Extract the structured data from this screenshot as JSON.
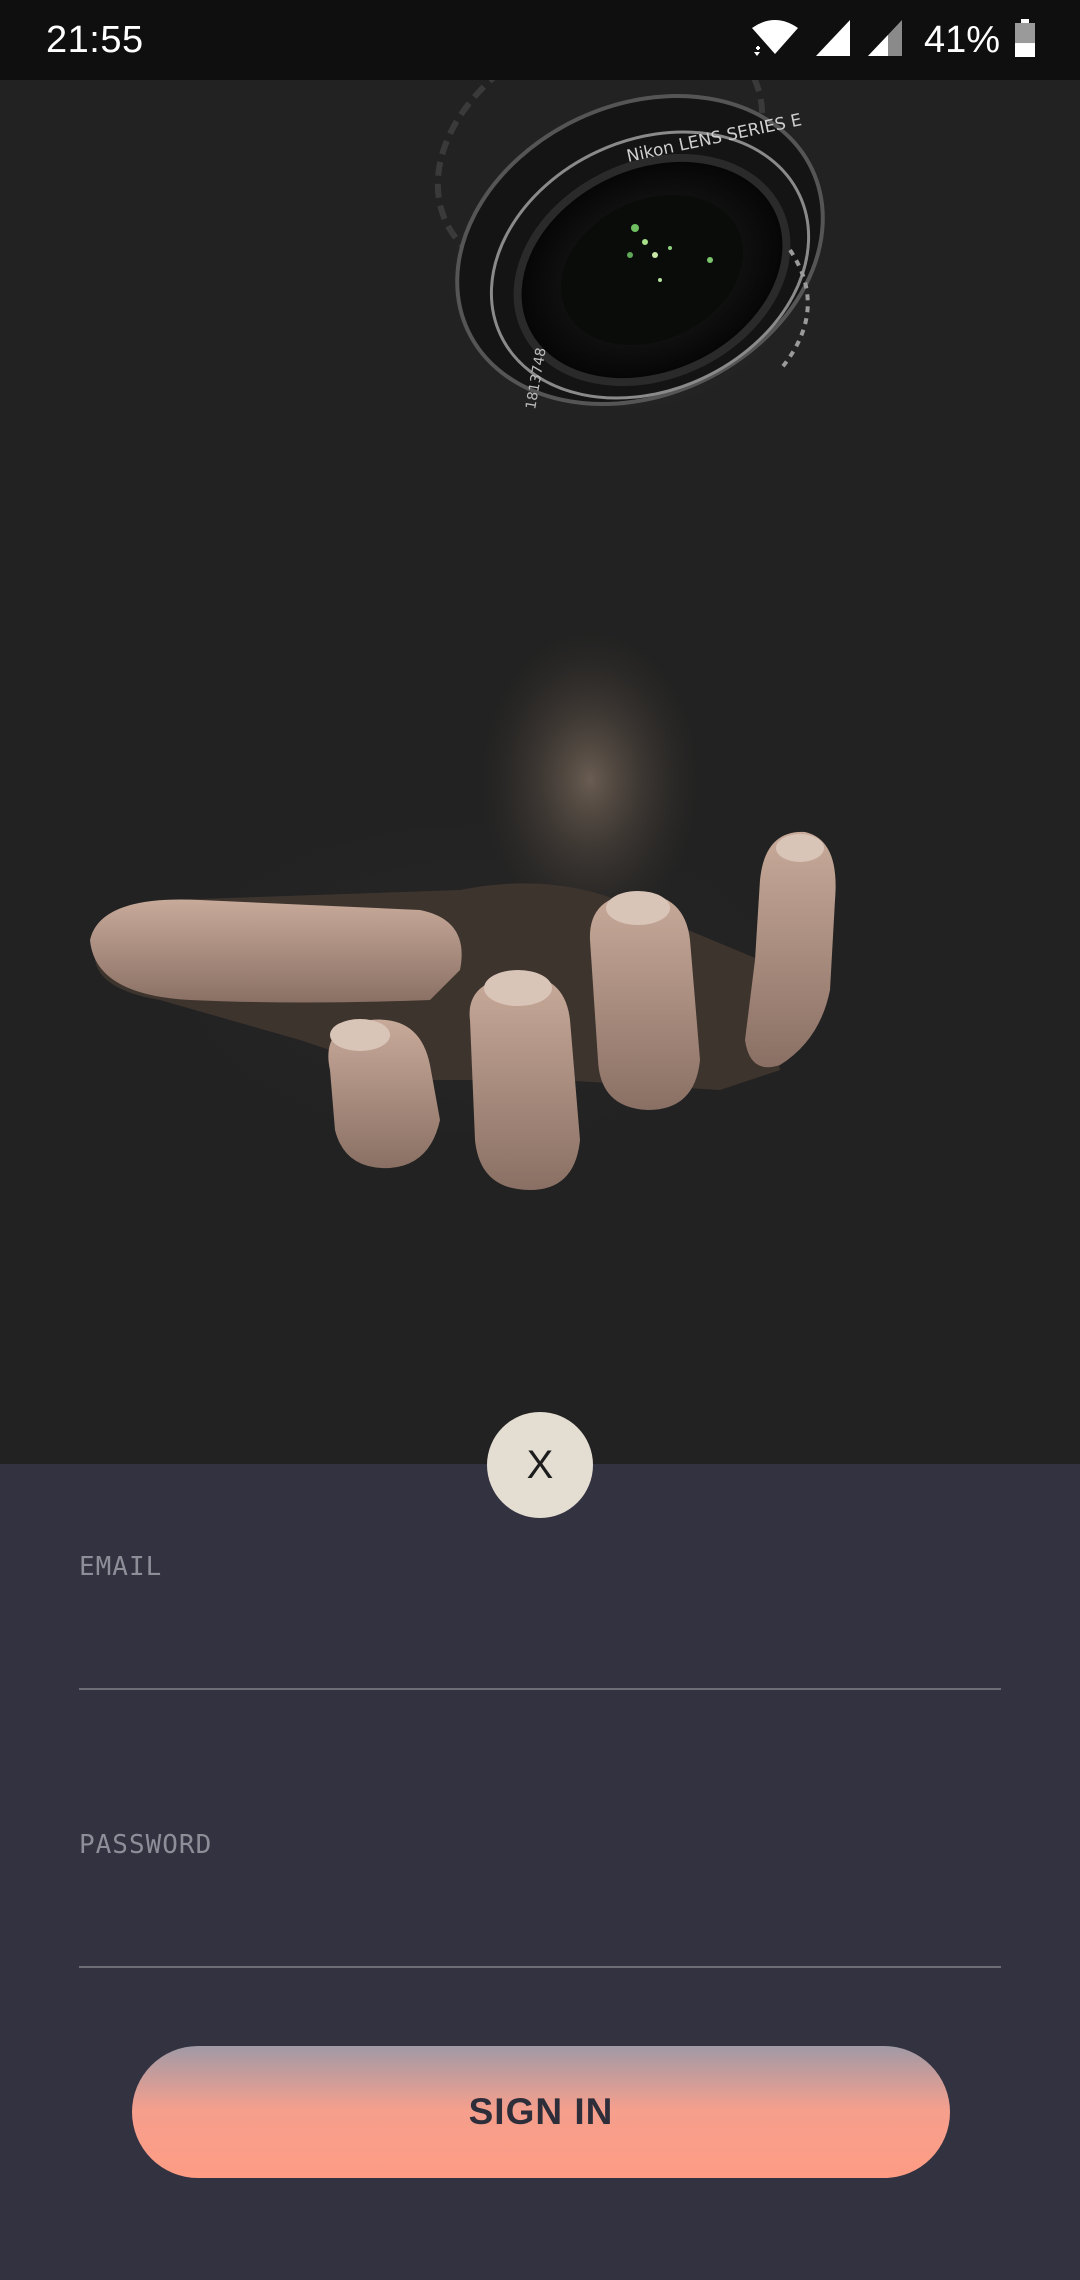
{
  "status_bar": {
    "time": "21:55",
    "battery_percent": "41%",
    "battery_level": 0.41,
    "icons": [
      "wifi-icon",
      "cell-signal-icon",
      "cell-signal-weak-icon",
      "battery-icon"
    ]
  },
  "hero": {
    "lens_text_top": "Nikon LENS SERIES E",
    "lens_serial": "1813748"
  },
  "close_button": {
    "label": "X"
  },
  "form": {
    "email": {
      "label": "EMAIL",
      "value": ""
    },
    "password": {
      "label": "PASSWORD",
      "value": ""
    },
    "submit_label": "SIGN IN"
  },
  "colors": {
    "status_bar_bg": "#0f0f10",
    "hero_bg": "#222222",
    "panel_bg": "#323240",
    "close_button_bg": "#e4ddd2",
    "button_gradient_top": "#a09aa6",
    "button_gradient_bottom": "#fe9c84",
    "label_color": "#8d8e98"
  }
}
